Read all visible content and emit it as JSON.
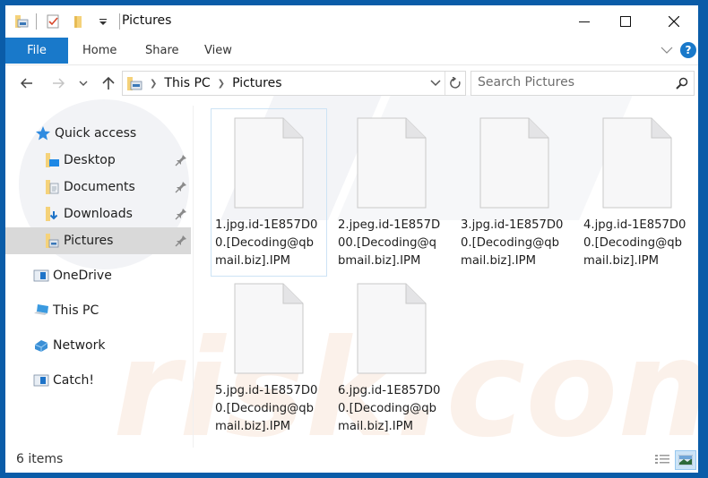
{
  "window": {
    "title": "Pictures",
    "controls": {
      "minimize": "minimize",
      "maximize": "maximize",
      "close": "close"
    }
  },
  "quick_access_toolbar": {
    "icons": [
      "folder-picture-icon",
      "properties-checkmark-icon",
      "new-folder-icon",
      "customize-dropdown-icon"
    ]
  },
  "ribbon": {
    "tabs": [
      {
        "label": "File",
        "active": true
      },
      {
        "label": "Home"
      },
      {
        "label": "Share"
      },
      {
        "label": "View"
      }
    ],
    "accent": "#1979ca",
    "help_label": "?"
  },
  "navigation": {
    "back": "back",
    "forward": "forward",
    "recent": "recent-locations",
    "up": "up",
    "breadcrumb": [
      "This PC",
      "Pictures"
    ],
    "search_placeholder": "Search Pictures",
    "search_value": ""
  },
  "sidebar": {
    "items": [
      {
        "label": "Quick access",
        "icon": "star-icon",
        "pinned": false,
        "selected": false
      },
      {
        "label": "Desktop",
        "icon": "desktop-folder-icon",
        "pinned": true,
        "selected": false
      },
      {
        "label": "Documents",
        "icon": "documents-folder-icon",
        "pinned": true,
        "selected": false
      },
      {
        "label": "Downloads",
        "icon": "downloads-folder-icon",
        "pinned": true,
        "selected": false
      },
      {
        "label": "Pictures",
        "icon": "pictures-folder-icon",
        "pinned": true,
        "selected": true
      },
      {
        "label": "OneDrive",
        "icon": "onedrive-icon",
        "pinned": false,
        "selected": false
      },
      {
        "label": "This PC",
        "icon": "computer-icon",
        "pinned": false,
        "selected": false
      },
      {
        "label": "Network",
        "icon": "network-icon",
        "pinned": false,
        "selected": false
      },
      {
        "label": "Catch!",
        "icon": "drive-icon",
        "pinned": false,
        "selected": false
      }
    ]
  },
  "files": [
    {
      "name": "1.jpg.id-1E857D00.[Decoding@qbmail.biz].IPM",
      "line1": "1.jpg.id-1E857D0",
      "line2": "0.[Decoding@qb",
      "line3": "mail.biz].IPM"
    },
    {
      "name": "2.jpeg.id-1E857D00.[Decoding@qbmail.biz].IPM",
      "line1": "2.jpeg.id-1E857D",
      "line2": "00.[Decoding@q",
      "line3": "bmail.biz].IPM"
    },
    {
      "name": "3.jpg.id-1E857D00.[Decoding@qbmail.biz].IPM",
      "line1": "3.jpg.id-1E857D0",
      "line2": "0.[Decoding@qb",
      "line3": "mail.biz].IPM"
    },
    {
      "name": "4.jpg.id-1E857D00.[Decoding@qbmail.biz].IPM",
      "line1": "4.jpg.id-1E857D0",
      "line2": "0.[Decoding@qb",
      "line3": "mail.biz].IPM"
    },
    {
      "name": "5.jpg.id-1E857D00.[Decoding@qbmail.biz].IPM",
      "line1": "5.jpg.id-1E857D0",
      "line2": "0.[Decoding@qb",
      "line3": "mail.biz].IPM"
    },
    {
      "name": "6.jpg.id-1E857D00.[Decoding@qbmail.biz].IPM",
      "line1": "6.jpg.id-1E857D0",
      "line2": "0.[Decoding@qb",
      "line3": "mail.biz].IPM"
    }
  ],
  "status_bar": {
    "item_count": "6 items",
    "views": [
      {
        "name": "details-view",
        "active": false
      },
      {
        "name": "large-icons-view",
        "active": true
      }
    ]
  },
  "colors": {
    "frame": "#0a5ca8",
    "accent": "#1979ca",
    "selection": "#d9d9d9",
    "focus_border": "#cde3f5"
  }
}
